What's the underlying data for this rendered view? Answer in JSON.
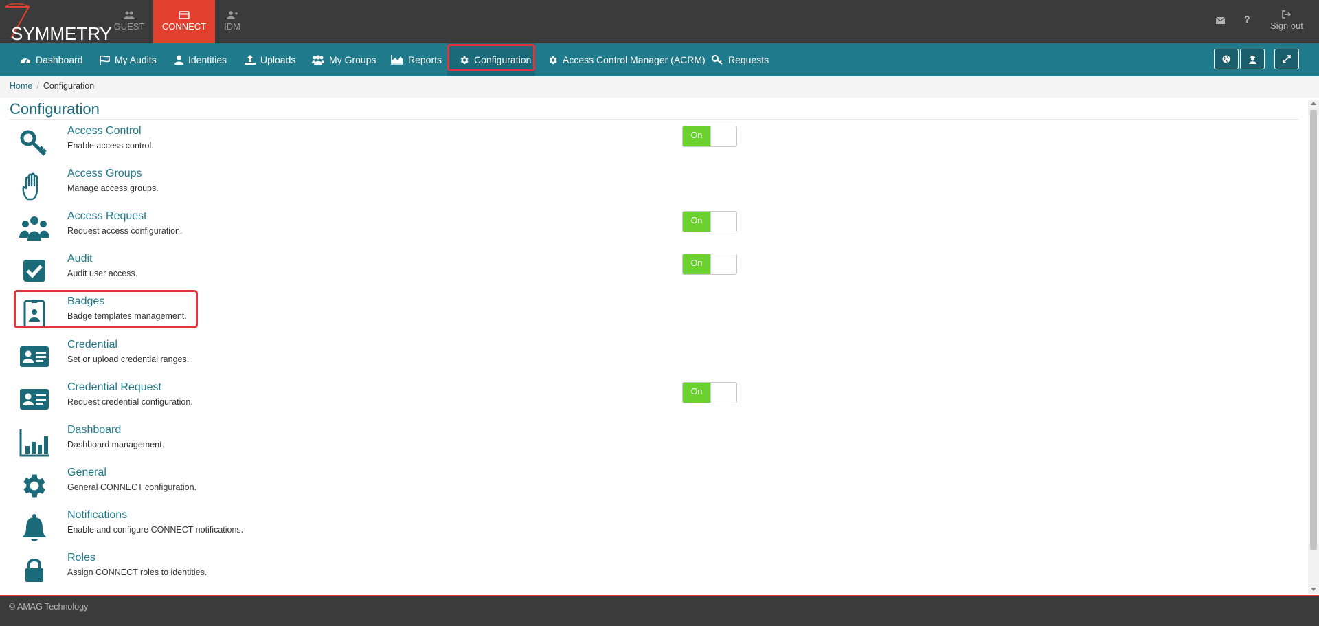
{
  "brand": {
    "logo_text": "SYMMETRY",
    "trademark": "™"
  },
  "app_tabs": [
    {
      "label": "GUEST",
      "icon": "users-icon"
    },
    {
      "label": "CONNECT",
      "icon": "card-icon"
    },
    {
      "label": "IDM",
      "icon": "user-plus-icon"
    }
  ],
  "top_right": {
    "mail_icon": "envelope-icon",
    "help": "?",
    "signout_label": "Sign out"
  },
  "nav": {
    "items": [
      {
        "label": "Dashboard",
        "icon": "tachometer-icon"
      },
      {
        "label": "My Audits",
        "icon": "flag-icon"
      },
      {
        "label": "Identities",
        "icon": "user-icon"
      },
      {
        "label": "Uploads",
        "icon": "upload-icon"
      },
      {
        "label": "My Groups",
        "icon": "group-icon"
      },
      {
        "label": "Reports",
        "icon": "area-chart-icon"
      },
      {
        "label": "Configuration",
        "icon": "gear-icon"
      },
      {
        "label": "Access Control Manager (ACRM)",
        "icon": "gear-icon"
      },
      {
        "label": "Requests",
        "icon": "key-icon"
      }
    ],
    "active": "Configuration"
  },
  "breadcrumb": {
    "home": "Home",
    "separator": "/",
    "current": "Configuration"
  },
  "page_title": "Configuration",
  "config_items": [
    {
      "name": "Access Control",
      "desc": "Enable access control.",
      "toggle": "On",
      "icon": "key-icon"
    },
    {
      "name": "Access Groups",
      "desc": "Manage access groups.",
      "icon": "hand-icon"
    },
    {
      "name": "Access Request",
      "desc": "Request access configuration.",
      "toggle": "On",
      "icon": "users-icon"
    },
    {
      "name": "Audit",
      "desc": "Audit user access.",
      "toggle": "On",
      "icon": "check-square-icon"
    },
    {
      "name": "Badges",
      "desc": "Badge templates management.",
      "icon": "badge-icon"
    },
    {
      "name": "Credential",
      "desc": "Set or upload credential ranges.",
      "icon": "id-card-icon"
    },
    {
      "name": "Credential Request",
      "desc": "Request credential configuration.",
      "toggle": "On",
      "icon": "id-card-icon"
    },
    {
      "name": "Dashboard",
      "desc": "Dashboard management.",
      "icon": "bar-chart-icon"
    },
    {
      "name": "General",
      "desc": "General CONNECT configuration.",
      "icon": "gear-icon"
    },
    {
      "name": "Notifications",
      "desc": "Enable and configure CONNECT notifications.",
      "icon": "bell-icon"
    },
    {
      "name": "Roles",
      "desc": "Assign CONNECT roles to identities.",
      "icon": "lock-icon"
    }
  ],
  "footer": {
    "text": "© AMAG Technology"
  },
  "colors": {
    "topbar": "#3b3b3b",
    "accent_red": "#e2402e",
    "nav_teal": "#1f7a8c",
    "toggle_green": "#6ad12e",
    "icon_teal": "#1b6a7a"
  }
}
